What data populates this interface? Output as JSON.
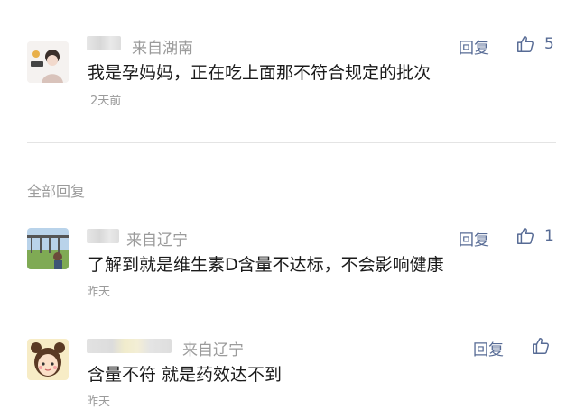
{
  "pinned_comment": {
    "location": "来自湖南",
    "reply_label": "回复",
    "like_count": "5",
    "content": "我是孕妈妈，正在吃上面那不符合规定的批次",
    "time": "2天前"
  },
  "section": {
    "title": "全部回复"
  },
  "replies": [
    {
      "location": "来自辽宁",
      "reply_label": "回复",
      "like_count": "1",
      "content": "了解到就是维生素D含量不达标，不会影响健康",
      "time": "昨天"
    },
    {
      "location": "来自辽宁",
      "reply_label": "回复",
      "like_count": "",
      "content": "含量不符 就是药效达不到",
      "time": "昨天"
    }
  ],
  "icons": {
    "like": "thumbs-up-icon"
  },
  "colors": {
    "link": "#576b95",
    "meta": "#9b9b9b",
    "text": "#1a1a1a"
  }
}
